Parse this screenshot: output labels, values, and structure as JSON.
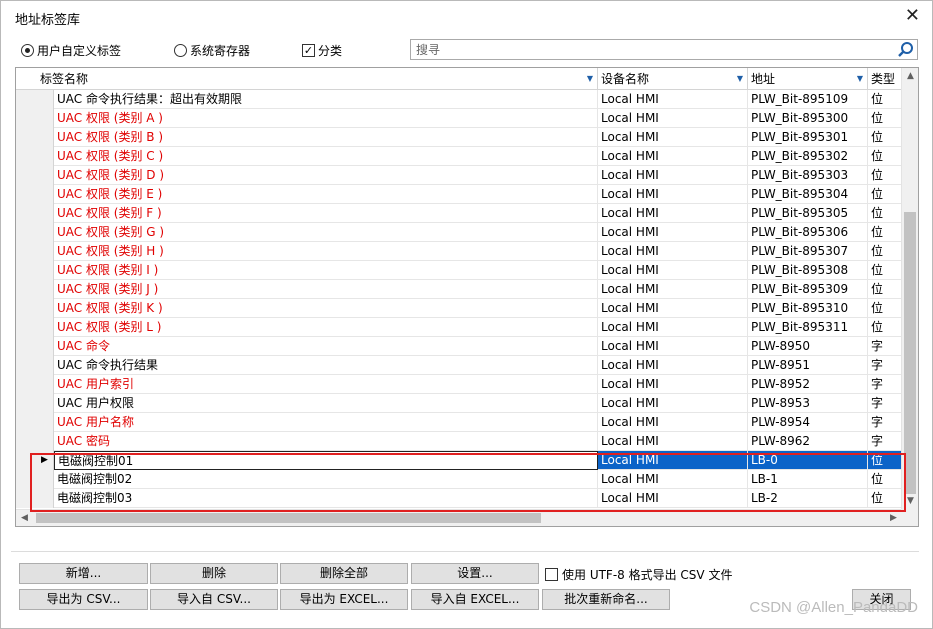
{
  "window": {
    "title": "地址标签库",
    "close_glyph": "✕"
  },
  "filters": {
    "radio_user": "用户自定义标签",
    "radio_system": "系统寄存器",
    "check_classify": "分类",
    "search_placeholder": "搜寻"
  },
  "columns": {
    "name": "标签名称",
    "device": "设备名称",
    "address": "地址",
    "type": "类型"
  },
  "rows": [
    {
      "name": "UAC 命令执行结果：超出有效期限",
      "device": "Local HMI",
      "address": "PLW_Bit-895109",
      "type": "位",
      "red": false
    },
    {
      "name": "UAC 权限 (类别 A )",
      "device": "Local HMI",
      "address": "PLW_Bit-895300",
      "type": "位",
      "red": true
    },
    {
      "name": "UAC 权限 (类别 B )",
      "device": "Local HMI",
      "address": "PLW_Bit-895301",
      "type": "位",
      "red": true
    },
    {
      "name": "UAC 权限 (类别 C )",
      "device": "Local HMI",
      "address": "PLW_Bit-895302",
      "type": "位",
      "red": true
    },
    {
      "name": "UAC 权限 (类别 D )",
      "device": "Local HMI",
      "address": "PLW_Bit-895303",
      "type": "位",
      "red": true
    },
    {
      "name": "UAC 权限 (类别 E )",
      "device": "Local HMI",
      "address": "PLW_Bit-895304",
      "type": "位",
      "red": true
    },
    {
      "name": "UAC 权限 (类别 F )",
      "device": "Local HMI",
      "address": "PLW_Bit-895305",
      "type": "位",
      "red": true
    },
    {
      "name": "UAC 权限 (类别 G )",
      "device": "Local HMI",
      "address": "PLW_Bit-895306",
      "type": "位",
      "red": true
    },
    {
      "name": "UAC 权限 (类别 H )",
      "device": "Local HMI",
      "address": "PLW_Bit-895307",
      "type": "位",
      "red": true
    },
    {
      "name": "UAC 权限 (类别 I )",
      "device": "Local HMI",
      "address": "PLW_Bit-895308",
      "type": "位",
      "red": true
    },
    {
      "name": "UAC 权限 (类别 J )",
      "device": "Local HMI",
      "address": "PLW_Bit-895309",
      "type": "位",
      "red": true
    },
    {
      "name": "UAC 权限 (类别 K )",
      "device": "Local HMI",
      "address": "PLW_Bit-895310",
      "type": "位",
      "red": true
    },
    {
      "name": "UAC 权限 (类别 L )",
      "device": "Local HMI",
      "address": "PLW_Bit-895311",
      "type": "位",
      "red": true
    },
    {
      "name": "UAC 命令",
      "device": "Local HMI",
      "address": "PLW-8950",
      "type": "字",
      "red": true
    },
    {
      "name": "UAC 命令执行结果",
      "device": "Local HMI",
      "address": "PLW-8951",
      "type": "字",
      "red": false
    },
    {
      "name": "UAC 用户索引",
      "device": "Local HMI",
      "address": "PLW-8952",
      "type": "字",
      "red": true
    },
    {
      "name": "UAC 用户权限",
      "device": "Local HMI",
      "address": "PLW-8953",
      "type": "字",
      "red": false
    },
    {
      "name": "UAC 用户名称",
      "device": "Local HMI",
      "address": "PLW-8954",
      "type": "字",
      "red": true
    },
    {
      "name": "UAC 密码",
      "device": "Local HMI",
      "address": "PLW-8962",
      "type": "字",
      "red": true
    },
    {
      "name": "电磁阀控制01",
      "device": "Local HMI",
      "address": "LB-0",
      "type": "位",
      "red": false,
      "selected": true
    },
    {
      "name": "电磁阀控制02",
      "device": "Local HMI",
      "address": "LB-1",
      "type": "位",
      "red": false
    },
    {
      "name": "电磁阀控制03",
      "device": "Local HMI",
      "address": "LB-2",
      "type": "位",
      "red": false
    }
  ],
  "buttons": {
    "new": "新增...",
    "delete": "删除",
    "delete_all": "删除全部",
    "settings": "设置...",
    "export_csv": "导出为 CSV...",
    "import_csv": "导入自 CSV...",
    "export_excel": "导出为 EXCEL...",
    "import_excel": "导入自 EXCEL...",
    "batch_rename": "批次重新命名...",
    "close": "关闭"
  },
  "utf8_option": "使用 UTF-8 格式导出 CSV 文件",
  "watermark": "CSDN @Allen_PandaDD",
  "colors": {
    "selection": "#0b63c8",
    "red_text": "#e00000",
    "highlight_box": "#e02020"
  }
}
